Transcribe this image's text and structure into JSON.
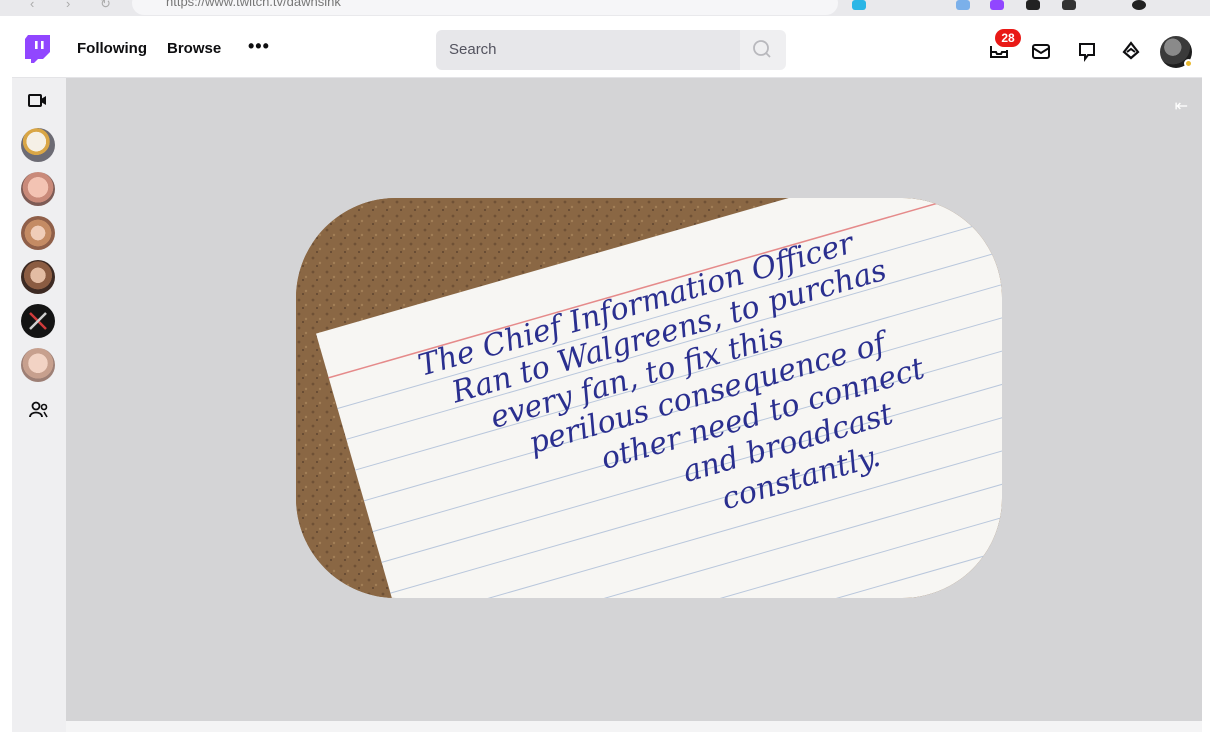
{
  "browser": {
    "url": "https://www.twitch.tv/dawnsink"
  },
  "topnav": {
    "following_label": "Following",
    "browse_label": "Browse",
    "more_label": "•••",
    "search_placeholder": "Search",
    "notification_count": "28"
  },
  "player": {
    "card_lines": [
      "The Chief Information Officer",
      "Ran to Walgreens, to purchas",
      "every fan, to fix this",
      "perilous consequence of",
      "other need to connect",
      "and broadcast",
      "constantly."
    ]
  },
  "colors": {
    "brand": "#9146ff",
    "badge": "#e91916",
    "ink": "#2a2f8f"
  }
}
